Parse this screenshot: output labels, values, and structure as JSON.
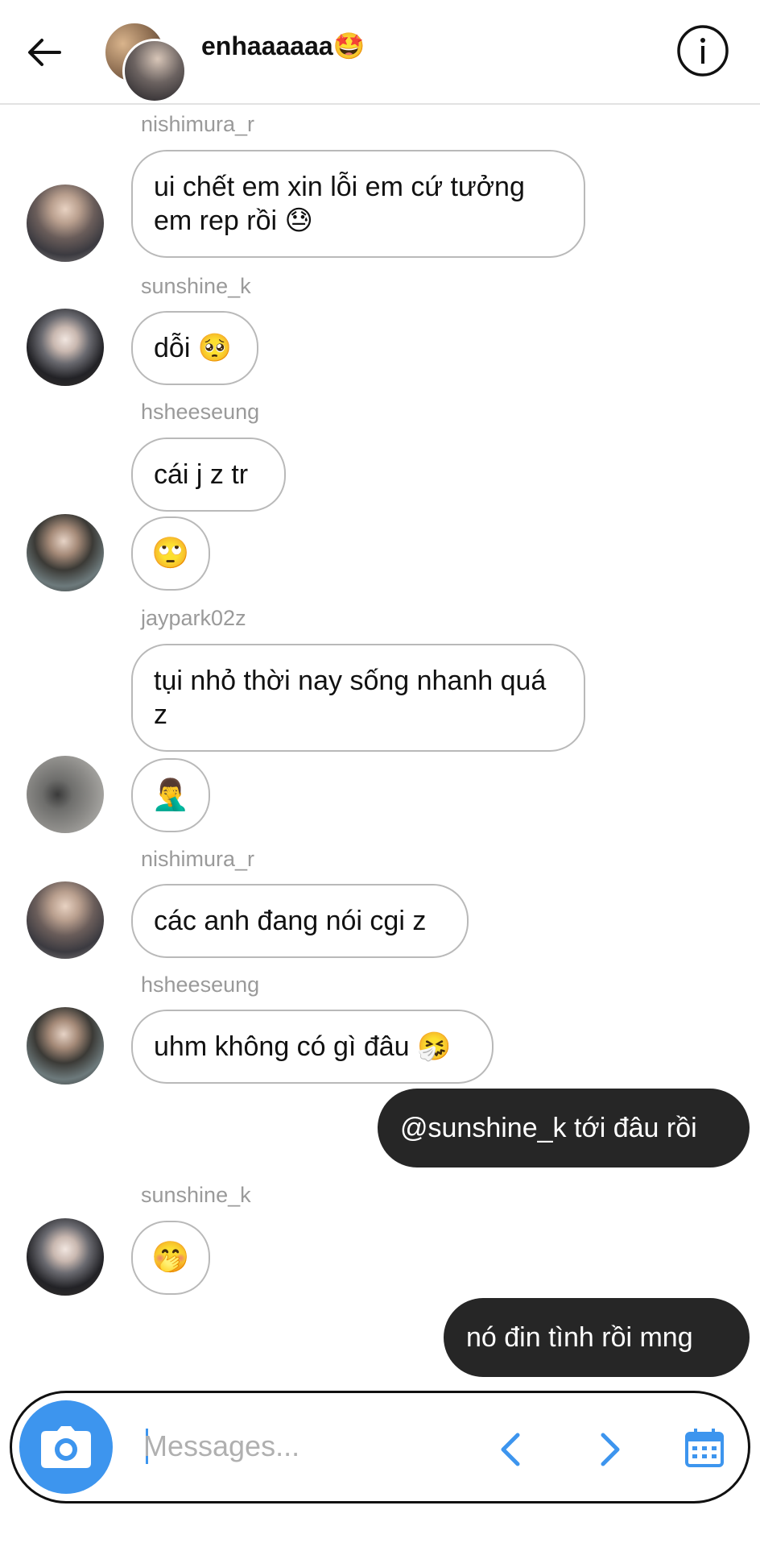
{
  "header": {
    "back_icon": "arrow-left-icon",
    "title": "enhaaaaaa",
    "title_emoji": "🤩",
    "info_icon": "info-circle-icon"
  },
  "messages": [
    {
      "user": "nishimura_r",
      "text": "ui chết em xin lỗi em cứ tưởng em rep rồi 😓"
    },
    {
      "user": "sunshine_k",
      "text": "dỗi 🥺"
    },
    {
      "user": "hsheeseung",
      "text": "cái j z tr",
      "emoji": "🙄"
    },
    {
      "user": "jaypark02z",
      "text": "tụi nhỏ thời nay sống nhanh quá z",
      "emoji": "🤦‍♂️"
    },
    {
      "user": "nishimura_r",
      "text": "các anh đang nói cgi z"
    },
    {
      "user": "hsheeseung",
      "text": "uhm không có gì đâu 🤧"
    },
    {
      "user": "sunshine_k",
      "emoji": "🤭"
    }
  ],
  "outgoing": [
    "@sunshine_k tới đâu rồi",
    "nó đin tình rồi mng"
  ],
  "composer": {
    "placeholder": "Messages...",
    "camera_icon": "camera-icon",
    "prev_icon": "chevron-left-icon",
    "next_icon": "chevron-right-icon",
    "calendar_icon": "calendar-icon",
    "accent_color": "#3d95ee"
  },
  "colors": {
    "outgoing_bubble": "#262626",
    "incoming_border": "#b9b9b9",
    "username_text": "#9a9a9a"
  }
}
